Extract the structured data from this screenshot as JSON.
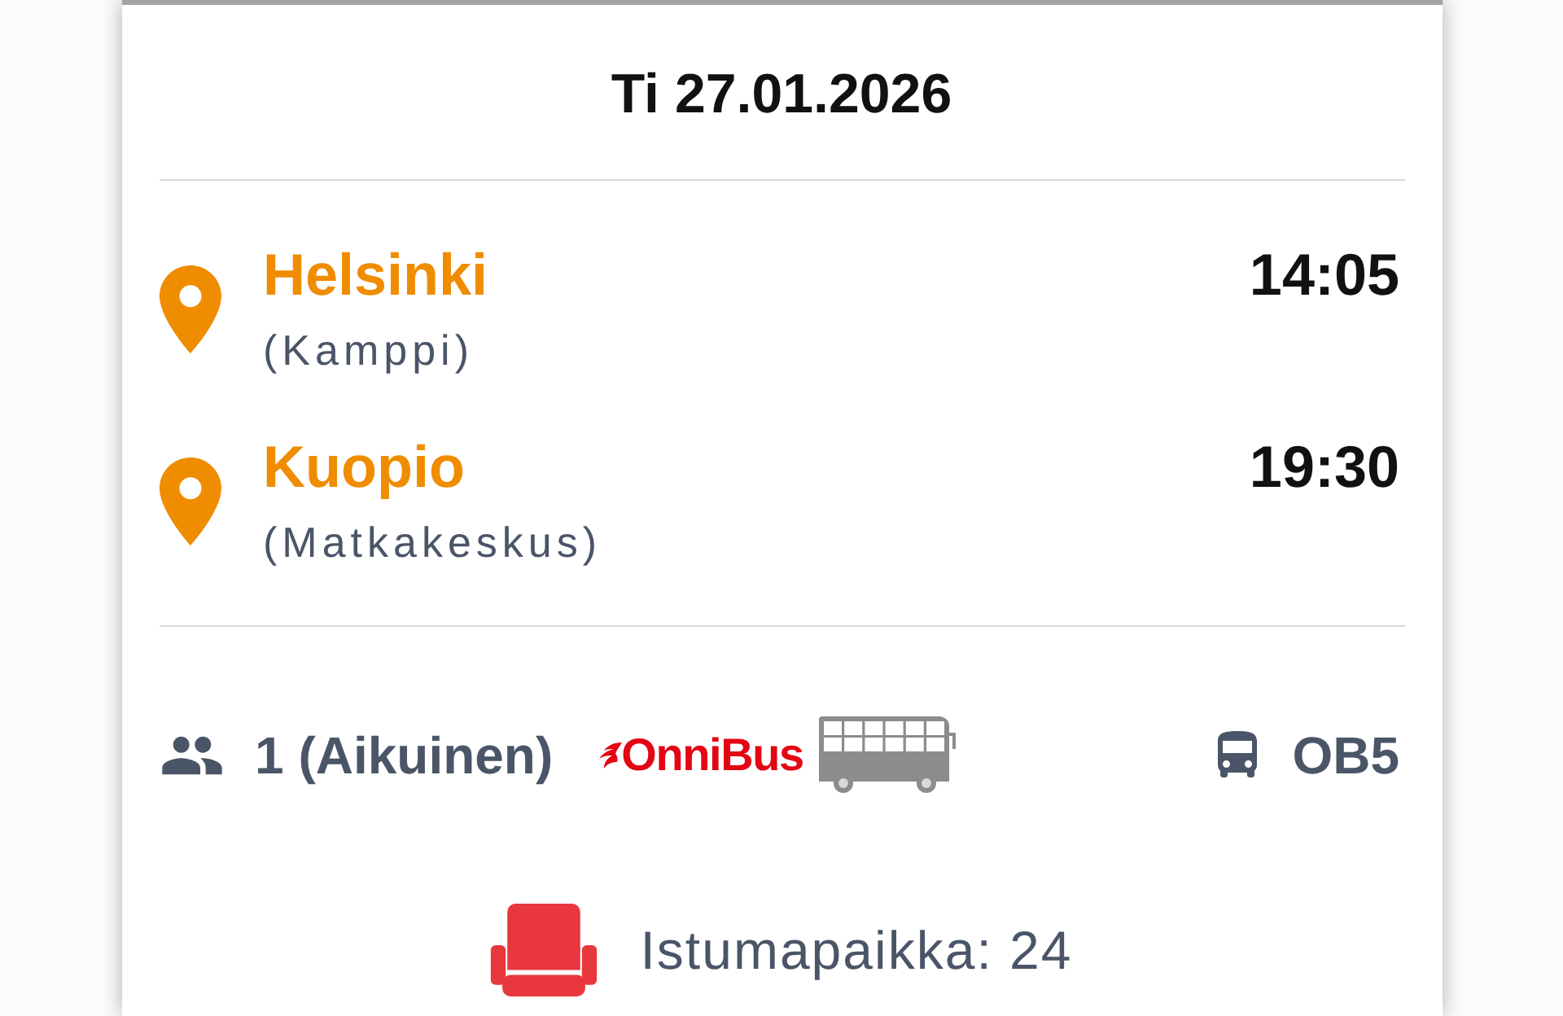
{
  "date": "Ti 27.01.2026",
  "stops": [
    {
      "city": "Helsinki",
      "station": "(Kamppi)",
      "time": "14:05"
    },
    {
      "city": "Kuopio",
      "station": "(Matkakeskus)",
      "time": "19:30"
    }
  ],
  "passengers": "1 (Aikuinen)",
  "operator": "OnniBus",
  "line": "OB5",
  "seat": "Istumapaikka: 24"
}
